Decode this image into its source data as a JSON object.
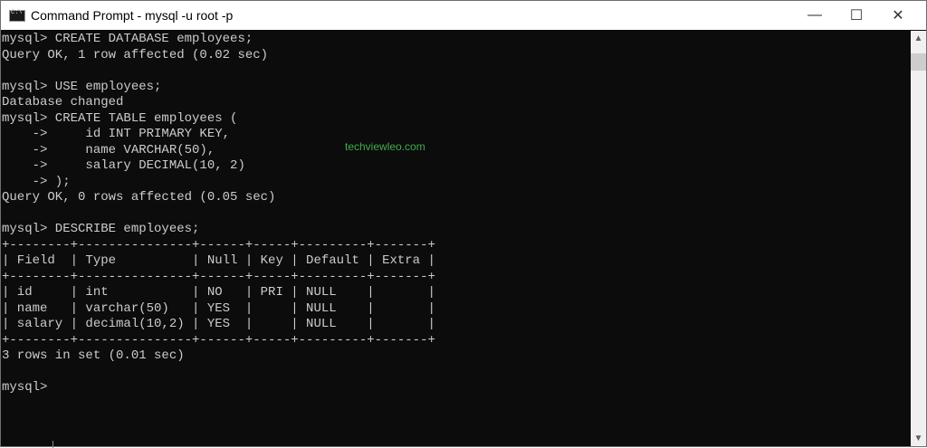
{
  "window": {
    "title": "Command Prompt - mysql  -u root -p",
    "controls": {
      "minimize": "—",
      "maximize": "☐",
      "close": "✕"
    }
  },
  "terminal": {
    "lines": [
      "mysql> CREATE DATABASE employees;",
      "Query OK, 1 row affected (0.02 sec)",
      "",
      "mysql> USE employees;",
      "Database changed",
      "mysql> CREATE TABLE employees (",
      "    ->     id INT PRIMARY KEY,",
      "    ->     name VARCHAR(50),",
      "    ->     salary DECIMAL(10, 2)",
      "    -> );",
      "Query OK, 0 rows affected (0.05 sec)",
      "",
      "mysql> DESCRIBE employees;",
      "+--------+---------------+------+-----+---------+-------+",
      "| Field  | Type          | Null | Key | Default | Extra |",
      "+--------+---------------+------+-----+---------+-------+",
      "| id     | int           | NO   | PRI | NULL    |       |",
      "| name   | varchar(50)   | YES  |     | NULL    |       |",
      "| salary | decimal(10,2) | YES  |     | NULL    |       |",
      "+--------+---------------+------+-----+---------+-------+",
      "3 rows in set (0.01 sec)",
      "",
      "mysql>"
    ],
    "watermark": "techviewleo.com"
  },
  "scrollbar": {
    "up": "▲",
    "down": "▼"
  }
}
